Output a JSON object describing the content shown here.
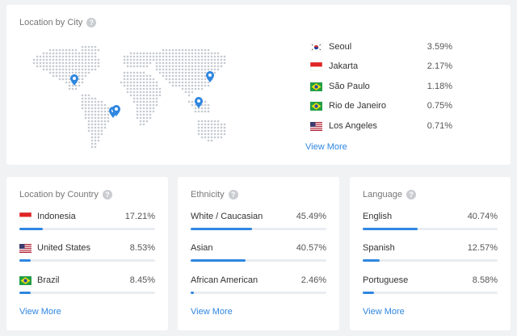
{
  "city": {
    "title": "Location by City",
    "help": "?",
    "items": [
      {
        "name": "Seoul",
        "pct": "3.59%",
        "flag": "south-korea-flag"
      },
      {
        "name": "Jakarta",
        "pct": "2.17%",
        "flag": "indonesia-flag"
      },
      {
        "name": "São Paulo",
        "pct": "1.18%",
        "flag": "brazil-flag"
      },
      {
        "name": "Rio de Janeiro",
        "pct": "0.75%",
        "flag": "brazil-flag"
      },
      {
        "name": "Los Angeles",
        "pct": "0.71%",
        "flag": "united-states-flag"
      }
    ],
    "view_more": "View More",
    "map_pins": [
      "los-angeles-pin",
      "sao-paulo-pin",
      "rio-de-janeiro-pin",
      "seoul-pin",
      "jakarta-pin"
    ]
  },
  "country": {
    "title": "Location by Country",
    "help": "?",
    "items": [
      {
        "name": "Indonesia",
        "pct": "17.21%",
        "share": 0.172,
        "flag": "indonesia-flag"
      },
      {
        "name": "United States",
        "pct": "8.53%",
        "share": 0.085,
        "flag": "united-states-flag"
      },
      {
        "name": "Brazil",
        "pct": "8.45%",
        "share": 0.084,
        "flag": "brazil-flag"
      }
    ],
    "view_more": "View More"
  },
  "ethnicity": {
    "title": "Ethnicity",
    "help": "?",
    "items": [
      {
        "name": "White / Caucasian",
        "pct": "45.49%",
        "share": 0.455
      },
      {
        "name": "Asian",
        "pct": "40.57%",
        "share": 0.406
      },
      {
        "name": "African American",
        "pct": "2.46%",
        "share": 0.025
      }
    ],
    "view_more": "View More"
  },
  "language": {
    "title": "Language",
    "help": "?",
    "items": [
      {
        "name": "English",
        "pct": "40.74%",
        "share": 0.407
      },
      {
        "name": "Spanish",
        "pct": "12.57%",
        "share": 0.126
      },
      {
        "name": "Portuguese",
        "pct": "8.58%",
        "share": 0.086
      }
    ],
    "view_more": "View More"
  },
  "colors": {
    "accent": "#2f86e0",
    "track": "#e9ecf1",
    "map_dot": "#c5c9d0"
  }
}
